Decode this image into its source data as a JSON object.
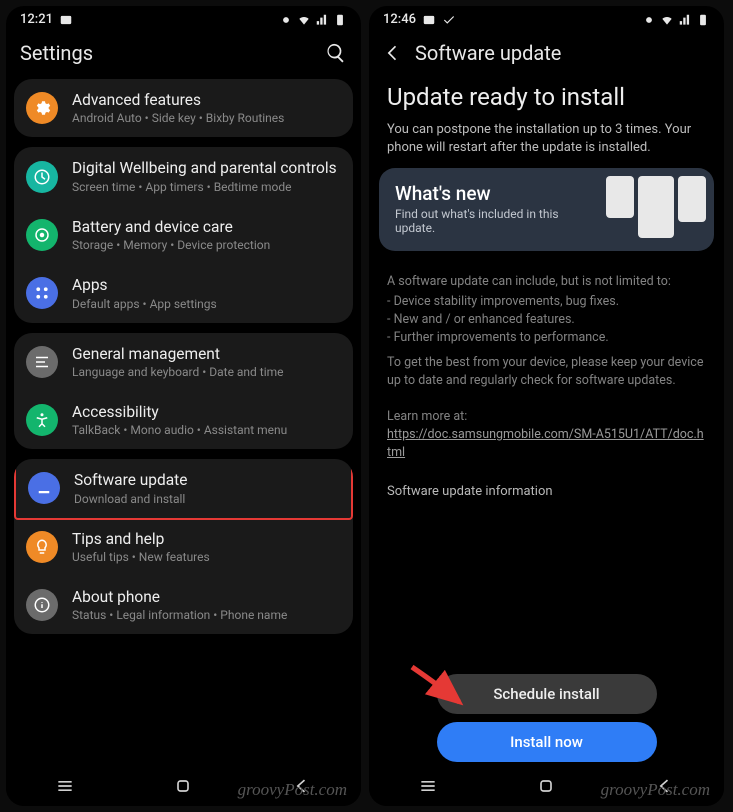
{
  "left": {
    "time": "12:21",
    "title": "Settings",
    "groups": [
      {
        "rows": [
          {
            "icon": "gear",
            "bg": "bg-orange",
            "title": "Advanced features",
            "sub": "Android Auto  •  Side key  •  Bixby Routines"
          }
        ]
      },
      {
        "rows": [
          {
            "icon": "wellbeing",
            "bg": "bg-teal",
            "title": "Digital Wellbeing and parental controls",
            "sub": "Screen time  •  App timers  •  Bedtime mode"
          },
          {
            "icon": "battery",
            "bg": "bg-green",
            "title": "Battery and device care",
            "sub": "Storage  •  Memory  •  Device protection"
          },
          {
            "icon": "apps",
            "bg": "bg-blue",
            "title": "Apps",
            "sub": "Default apps  •  App settings"
          }
        ]
      },
      {
        "rows": [
          {
            "icon": "general",
            "bg": "bg-gray",
            "title": "General management",
            "sub": "Language and keyboard  •  Date and time"
          },
          {
            "icon": "access",
            "bg": "bg-green",
            "title": "Accessibility",
            "sub": "TalkBack  •  Mono audio  •  Assistant menu"
          }
        ]
      },
      {
        "rows": [
          {
            "icon": "update",
            "bg": "bg-blue",
            "title": "Software update",
            "sub": "Download and install",
            "hl": true
          },
          {
            "icon": "tips",
            "bg": "bg-orange",
            "title": "Tips and help",
            "sub": "Useful tips  •  New features"
          },
          {
            "icon": "about",
            "bg": "bg-gray",
            "title": "About phone",
            "sub": "Status  •  Legal information  •  Phone name"
          }
        ]
      }
    ]
  },
  "right": {
    "time": "12:46",
    "title": "Software update",
    "heading": "Update ready to install",
    "intro": "You can postpone the installation up to 3 times. Your phone will restart after the update is installed.",
    "card_title": "What's new",
    "card_sub": "Find out what's included in this update.",
    "info_lead": "A software update can include, but is not limited to:",
    "bullets": [
      "Device stability improvements, bug fixes.",
      "New and / or enhanced features.",
      "Further improvements to performance."
    ],
    "info_tail": "To get the best from your device, please keep your device up to date and regularly check for software updates.",
    "learn": "Learn more at:",
    "link": "https://doc.samsungmobile.com/SM-A515U1/ATT/doc.html",
    "sec2": "Software update information",
    "btn_schedule": "Schedule install",
    "btn_install": "Install now"
  },
  "watermark": "groovyPost.com"
}
